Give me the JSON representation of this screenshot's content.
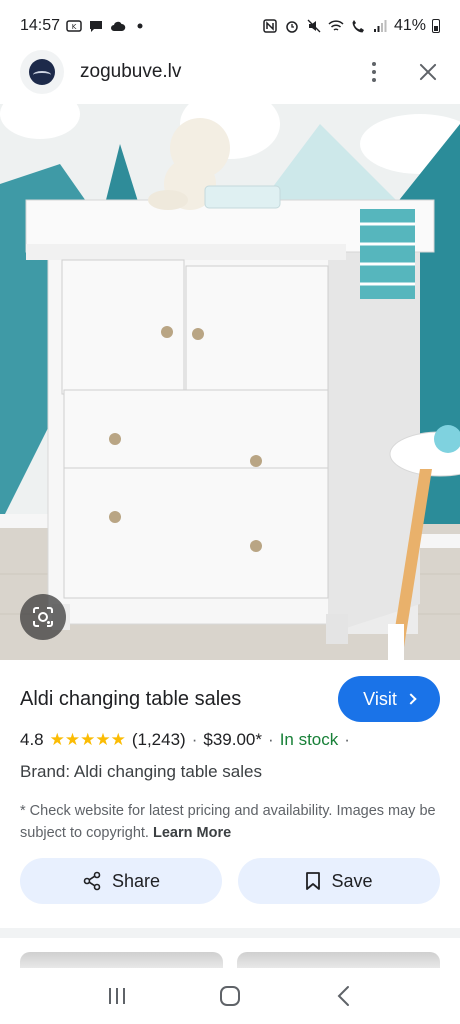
{
  "status_bar": {
    "time": "14:57",
    "battery": "41%"
  },
  "header": {
    "site_name": "zogubuve.lv",
    "icons": [
      "site-logo-icon",
      "more-vert-icon",
      "close-icon"
    ]
  },
  "image": {
    "alt_subject": "white changing table",
    "lens_icon": "lens-search-icon"
  },
  "product": {
    "title": "Aldi changing table sales",
    "visit_label": "Visit",
    "rating": "4.8",
    "stars": "★★★★★",
    "review_count": "(1,243)",
    "price": "$39.00*",
    "availability": "In stock",
    "brand_line": "Brand: Aldi changing table sales",
    "disclaimer": "* Check website for latest pricing and availability. Images may be subject to copyright.",
    "learn_more": "Learn More"
  },
  "actions": {
    "share_label": "Share",
    "save_label": "Save"
  },
  "colors": {
    "accent": "#1a73e8",
    "star": "#fbbc04",
    "in_stock": "#188038",
    "pill_bg": "#e8f0fe"
  },
  "nav": {
    "icons": [
      "recents-icon",
      "home-icon",
      "back-icon"
    ]
  }
}
